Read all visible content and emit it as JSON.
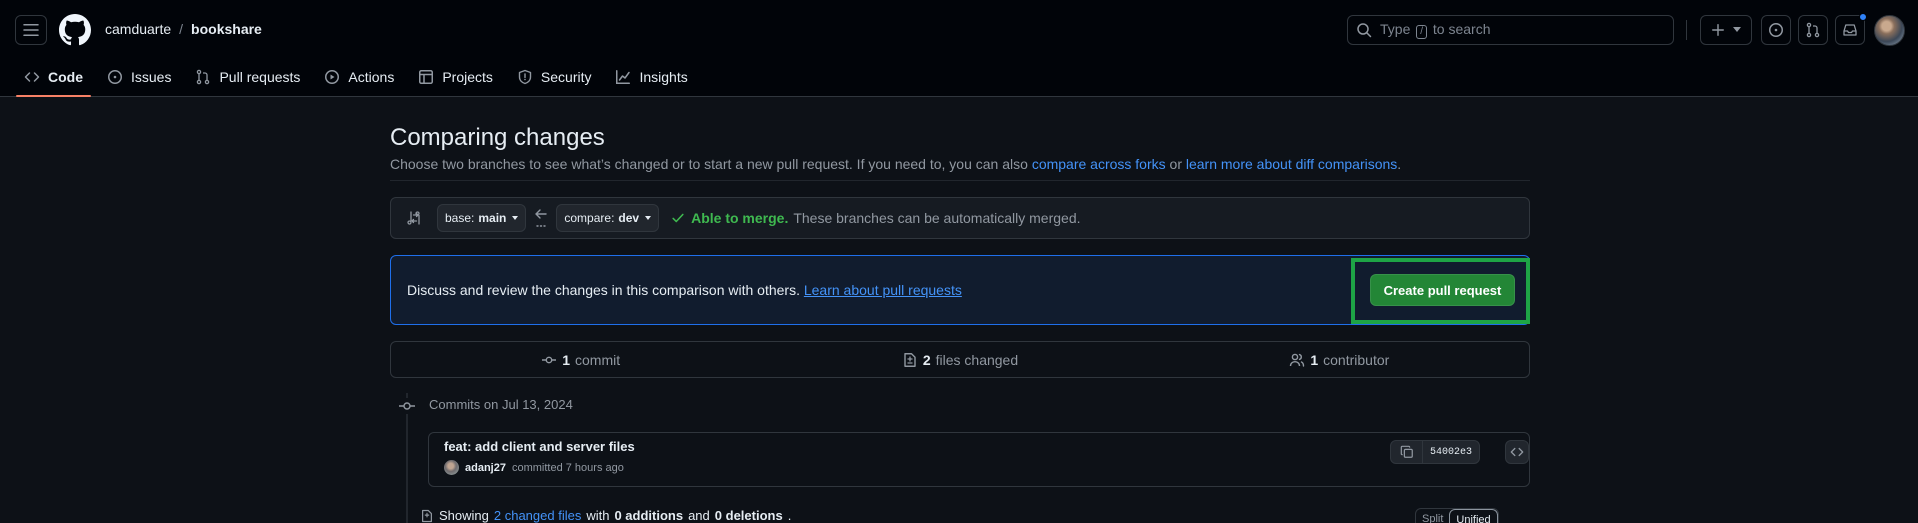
{
  "header": {
    "owner": "camduarte",
    "separator": "/",
    "repo": "bookshare",
    "search_prefix": "Type",
    "search_key": "/",
    "search_suffix": "to search"
  },
  "nav": {
    "items": [
      {
        "label": "Code",
        "icon": "code-icon"
      },
      {
        "label": "Issues",
        "icon": "issue-opened-icon"
      },
      {
        "label": "Pull requests",
        "icon": "git-pull-request-icon"
      },
      {
        "label": "Actions",
        "icon": "play-icon"
      },
      {
        "label": "Projects",
        "icon": "table-icon"
      },
      {
        "label": "Security",
        "icon": "shield-icon"
      },
      {
        "label": "Insights",
        "icon": "graph-icon"
      }
    ],
    "active": "Code"
  },
  "compare": {
    "title": "Comparing changes",
    "description_prefix": "Choose two branches to see what’s changed or to start a new pull request. If you need to, you can also",
    "link_forks": "compare across forks",
    "description_or": "or",
    "link_learn_diff": "learn more about diff comparisons",
    "description_end": ".",
    "base_prefix": "base:",
    "base_branch": "main",
    "compare_prefix": "compare:",
    "compare_branch": "dev",
    "merge_status": "Able to merge.",
    "merge_text": "These branches can be automatically merged."
  },
  "pr_box": {
    "message": "Discuss and review the changes in this comparison with others.",
    "link": "Learn about pull requests",
    "button": "Create pull request"
  },
  "stats": {
    "commits_count": "1",
    "commits_label": "commit",
    "files_count": "2",
    "files_label": "files changed",
    "contributors_count": "1",
    "contributors_label": "contributor"
  },
  "commits": {
    "date_label": "Commits on Jul 13, 2024",
    "items": [
      {
        "title": "feat: add client and server files",
        "author": "adanj27",
        "meta": "committed 7 hours ago",
        "sha": "54002e3"
      }
    ]
  },
  "files_summary": {
    "prefix": "Showing",
    "changed_link": "2 changed files",
    "with": "with",
    "additions": "0 additions",
    "and": "and",
    "deletions": "0 deletions",
    "end": "."
  },
  "view_toggle": {
    "split": "Split",
    "unified": "Unified",
    "selected": "Unified"
  },
  "colors": {
    "accent_green": "#238636",
    "link_blue": "#4493f8",
    "highlight_border": "#1ea446",
    "nav_underline": "#f78166"
  }
}
